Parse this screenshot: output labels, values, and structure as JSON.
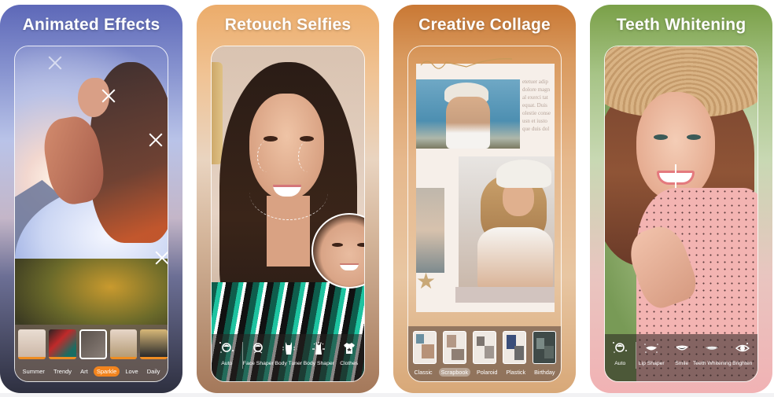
{
  "panels": [
    {
      "title": "Animated Effects",
      "theme_color": "#5d68b8",
      "filters": [
        {
          "label": "Summer",
          "active": false
        },
        {
          "label": "Trendy",
          "active": false
        },
        {
          "label": "Art",
          "active": false
        },
        {
          "label": "Sparkle",
          "active": true
        },
        {
          "label": "Love",
          "active": false
        },
        {
          "label": "Daily",
          "active": false
        }
      ],
      "active_filter_color": "#f2841e",
      "selected_thumbnail_index": 2
    },
    {
      "title": "Retouch Selfies",
      "theme_color": "#ecac6a",
      "tools": [
        {
          "label": "Auto",
          "icon": "auto-face-icon"
        },
        {
          "label": "Face Shaper",
          "icon": "face-shaper-icon"
        },
        {
          "label": "Body Tuner",
          "icon": "body-tuner-icon"
        },
        {
          "label": "Body Shaper",
          "icon": "body-shaper-icon"
        },
        {
          "label": "Clothes",
          "icon": "clothes-icon"
        }
      ]
    },
    {
      "title": "Creative Collage",
      "theme_color": "#c97834",
      "collage_text": [
        "etetuer adip",
        "dolore magn",
        "al exerci tat",
        "equat. Duis",
        "olestie conse",
        "usn et iusto",
        "que duis dol"
      ],
      "layouts": [
        {
          "label": "Classic",
          "active": false
        },
        {
          "label": "Scrapbook",
          "active": true
        },
        {
          "label": "Polaroid",
          "active": false
        },
        {
          "label": "Plastick",
          "active": false
        },
        {
          "label": "Birthday",
          "active": false
        }
      ]
    },
    {
      "title": "Teeth Whitening",
      "theme_color": "#7aa048",
      "tools": [
        {
          "label": "Auto",
          "icon": "auto-face-icon"
        },
        {
          "label": "Lip Shaper",
          "icon": "lip-shaper-icon"
        },
        {
          "label": "Smile",
          "icon": "smile-icon"
        },
        {
          "label": "Teeth Whitening",
          "icon": "teeth-whitening-icon"
        },
        {
          "label": "Brighten",
          "icon": "eye-brighten-icon"
        }
      ]
    }
  ]
}
